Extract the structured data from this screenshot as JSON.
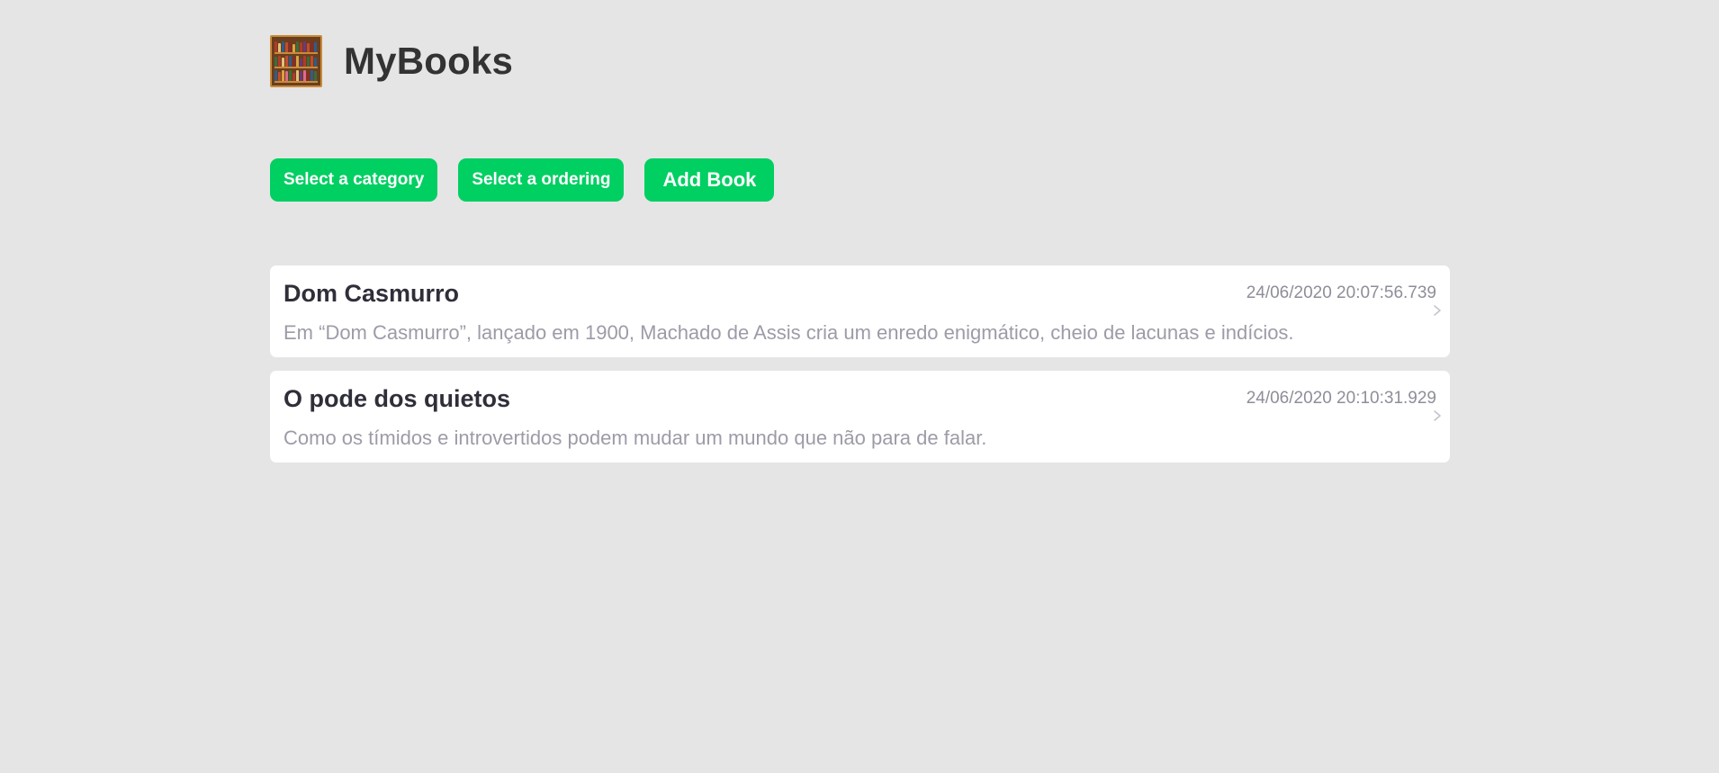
{
  "app": {
    "title": "MyBooks",
    "logo_icon": "bookshelf-icon"
  },
  "toolbar": {
    "category_label": "Select a category",
    "ordering_label": "Select a ordering",
    "add_label": "Add Book"
  },
  "colors": {
    "background": "#e5e5e5",
    "accent": "#00cf62",
    "card": "#ffffff",
    "title_text": "#333333",
    "muted_text": "#9c9ca8"
  },
  "books": [
    {
      "title": "Dom Casmurro",
      "date": "24/06/2020 20:07:56.739",
      "description": "Em “Dom Casmurro”, lançado em 1900, Machado de Assis cria um enredo enigmático, cheio de lacunas e indícios.",
      "icon": "chevron-right-icon"
    },
    {
      "title": "O pode dos quietos",
      "date": "24/06/2020 20:10:31.929",
      "description": "Como os tímidos e introvertidos podem mudar um mundo que não para de falar.",
      "icon": "chevron-right-icon"
    }
  ]
}
